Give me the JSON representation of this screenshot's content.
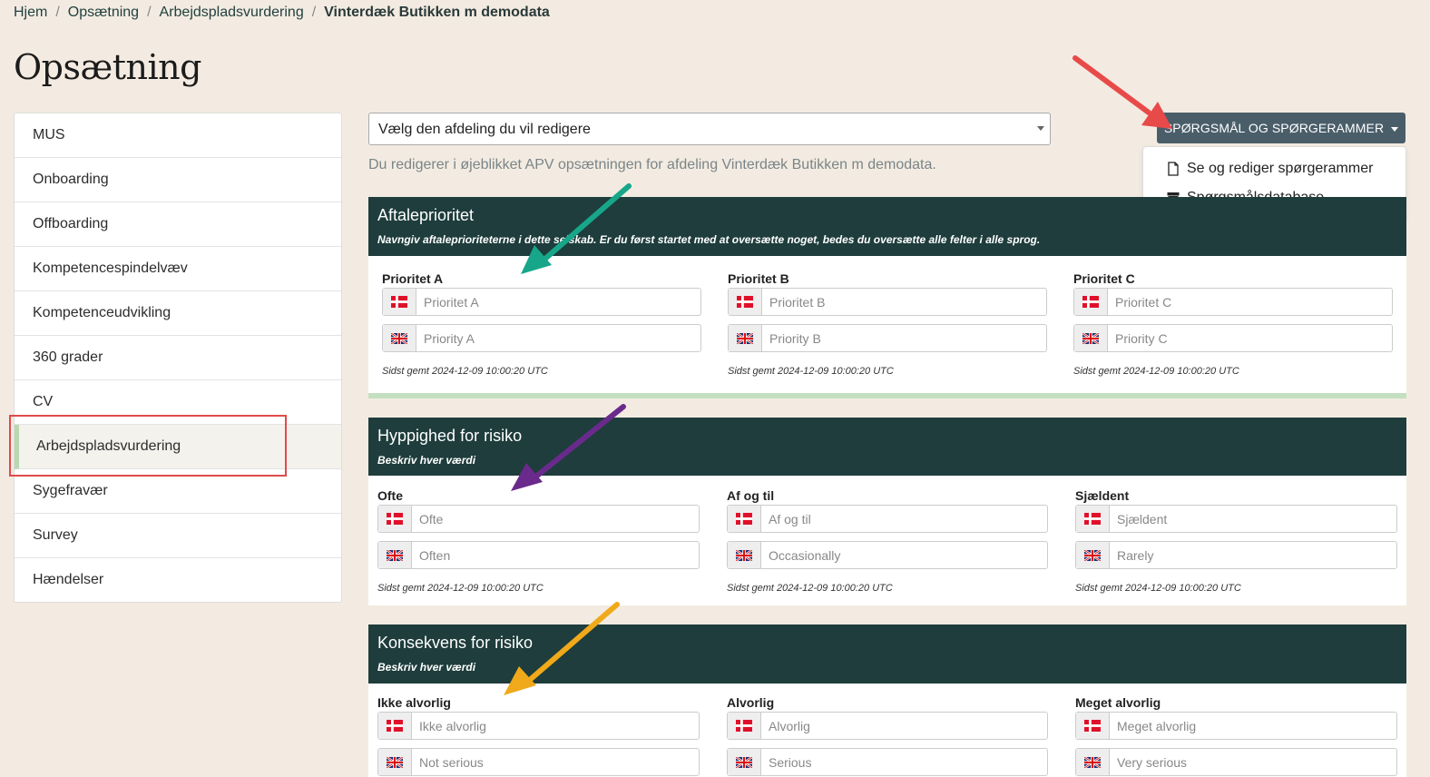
{
  "breadcrumb": [
    "Hjem",
    "Opsætning",
    "Arbejdspladsvurdering",
    "Vinterdæk Butikken m demodata"
  ],
  "page_title": "Opsætning",
  "sidebar": {
    "items": [
      {
        "label": "MUS"
      },
      {
        "label": "Onboarding"
      },
      {
        "label": "Offboarding"
      },
      {
        "label": "Kompetencespindelvæv"
      },
      {
        "label": "Kompetenceudvikling"
      },
      {
        "label": "360 grader"
      },
      {
        "label": "CV"
      },
      {
        "label": "Arbejdspladsvurdering",
        "active": true
      },
      {
        "label": "Sygefravær"
      },
      {
        "label": "Survey"
      },
      {
        "label": "Hændelser"
      }
    ]
  },
  "department_select": {
    "value": "Vælg den afdeling du vil redigere"
  },
  "info_text": "Du redigerer i øjeblikket APV opsætningen for afdeling Vinterdæk Butikken m demodata.",
  "dropdown": {
    "button_label": "SPØRGSMÅL OG SPØRGERAMMER",
    "items": [
      {
        "label": "Se og rediger spørgerammer",
        "icon": "file-icon"
      },
      {
        "label": "Spørgsmålsdatabase",
        "icon": "archive-icon"
      }
    ]
  },
  "cards": [
    {
      "title": "Aftaleprioritet",
      "subtitle": "Navngiv aftaleprioriteterne i dette selskab. Er du først startet med at oversætte noget, bedes du oversætte alle felter i alle sprog.",
      "columns": [
        {
          "label": "Prioritet A",
          "da_placeholder": "Prioritet A",
          "en_placeholder": "Priority A",
          "saved": "Sidst gemt 2024-12-09 10:00:20 UTC"
        },
        {
          "label": "Prioritet B",
          "da_placeholder": "Prioritet B",
          "en_placeholder": "Priority B",
          "saved": "Sidst gemt 2024-12-09 10:00:20 UTC"
        },
        {
          "label": "Prioritet C",
          "da_placeholder": "Prioritet C",
          "en_placeholder": "Priority C",
          "saved": "Sidst gemt 2024-12-09 10:00:20 UTC"
        }
      ]
    },
    {
      "title": "Hyppighed for risiko",
      "subtitle": "Beskriv hver værdi",
      "columns": [
        {
          "label": "Ofte",
          "da_placeholder": "Ofte",
          "en_placeholder": "Often",
          "saved": "Sidst gemt 2024-12-09 10:00:20 UTC"
        },
        {
          "label": "Af og til",
          "da_placeholder": "Af og til",
          "en_placeholder": "Occasionally",
          "saved": "Sidst gemt 2024-12-09 10:00:20 UTC"
        },
        {
          "label": "Sjældent",
          "da_placeholder": "Sjældent",
          "en_placeholder": "Rarely",
          "saved": "Sidst gemt 2024-12-09 10:00:20 UTC"
        }
      ]
    },
    {
      "title": "Konsekvens for risiko",
      "subtitle": "Beskriv hver værdi",
      "columns": [
        {
          "label": "Ikke alvorlig",
          "da_placeholder": "Ikke alvorlig",
          "en_placeholder": "Not serious"
        },
        {
          "label": "Alvorlig",
          "da_placeholder": "Alvorlig",
          "en_placeholder": "Serious"
        },
        {
          "label": "Meget alvorlig",
          "da_placeholder": "Meget alvorlig",
          "en_placeholder": "Very serious"
        }
      ]
    }
  ],
  "colors": {
    "background": "#f3ebe1",
    "card_header": "#1e3d3c",
    "button": "#4a5e6a",
    "active_accent": "#b9d8b2",
    "annotation_red": "#e84a4a",
    "annotation_teal": "#17a68a",
    "annotation_purple": "#6a2a8c",
    "annotation_orange": "#f0a91a"
  }
}
